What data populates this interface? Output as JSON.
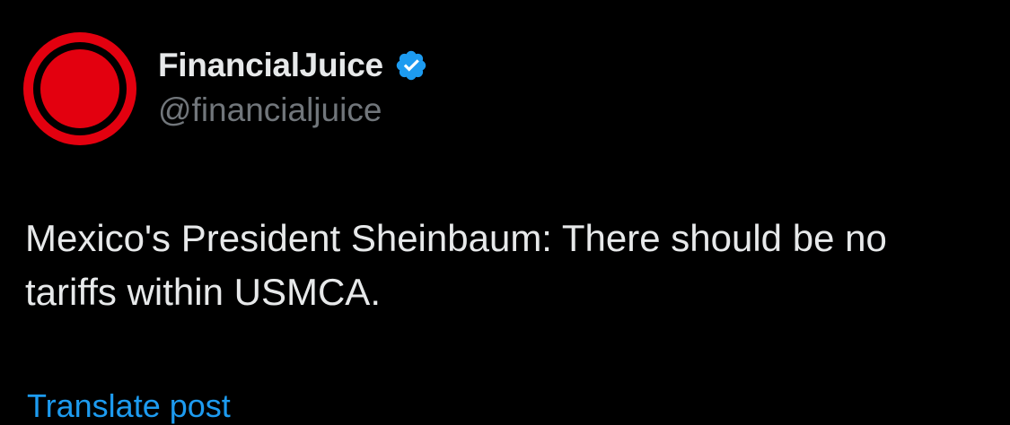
{
  "colors": {
    "background": "#000000",
    "text_primary": "#e7e9ea",
    "text_secondary": "#71767b",
    "accent": "#1d9bf0",
    "avatar_red": "#e3000f"
  },
  "author": {
    "display_name": "FinancialJuice",
    "handle": "@financialjuice",
    "avatar_icon": "red-circle-target-logo",
    "verified_icon": "verified-badge-icon"
  },
  "tweet": {
    "text": "Mexico's President Sheinbaum: There should be no tariffs within USMCA."
  },
  "footer": {
    "translate_label": "Translate post"
  }
}
